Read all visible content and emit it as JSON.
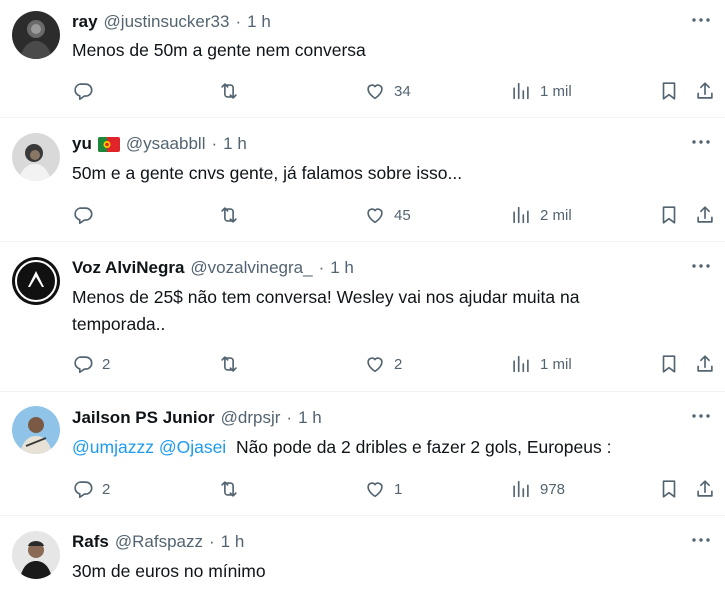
{
  "tweets": [
    {
      "name": "ray",
      "handle": "@justinsucker33",
      "time": "1 h",
      "text": "Menos de 50m a gente nem conversa",
      "replies": "",
      "reposts": "",
      "likes": "34",
      "views": "1 mil",
      "flag": false
    },
    {
      "name": "yu",
      "handle": "@ysaabbll",
      "time": "1 h",
      "text": "50m e a gente cnvs gente, já falamos sobre isso...",
      "replies": "",
      "reposts": "",
      "likes": "45",
      "views": "2 mil",
      "flag": true
    },
    {
      "name": "Voz AlviNegra",
      "handle": "@vozalvinegra_",
      "time": "1 h",
      "text_line1": "Menos de 25$ não tem conversa! Wesley vai nos ajudar muita na",
      "text_line2": "temporada..",
      "replies": "2",
      "reposts": "",
      "likes": "2",
      "views": "1 mil",
      "flag": false
    },
    {
      "name": "Jailson PS Junior",
      "handle": "@drpsjr",
      "time": "1 h",
      "mention1": "@umjazzz",
      "mention2": "@Ojasei",
      "text": "Não pode da 2 dribles e fazer 2 gols, Europeus :",
      "replies": "2",
      "reposts": "",
      "likes": "1",
      "views": "978",
      "flag": false
    },
    {
      "name": "Rafs",
      "handle": "@Rafspazz",
      "time": "1 h",
      "text": "30m de euros no mínimo",
      "flag": false
    }
  ],
  "separator_dot": "·",
  "colors": {
    "text_primary": "#0f1419",
    "text_secondary": "#536471",
    "link": "#1d9bf0",
    "divider": "#eff3f4"
  },
  "icons": [
    "reply-icon",
    "repost-icon",
    "like-icon",
    "views-icon",
    "bookmark-icon",
    "share-icon",
    "more-icon",
    "portugal-flag-icon"
  ]
}
